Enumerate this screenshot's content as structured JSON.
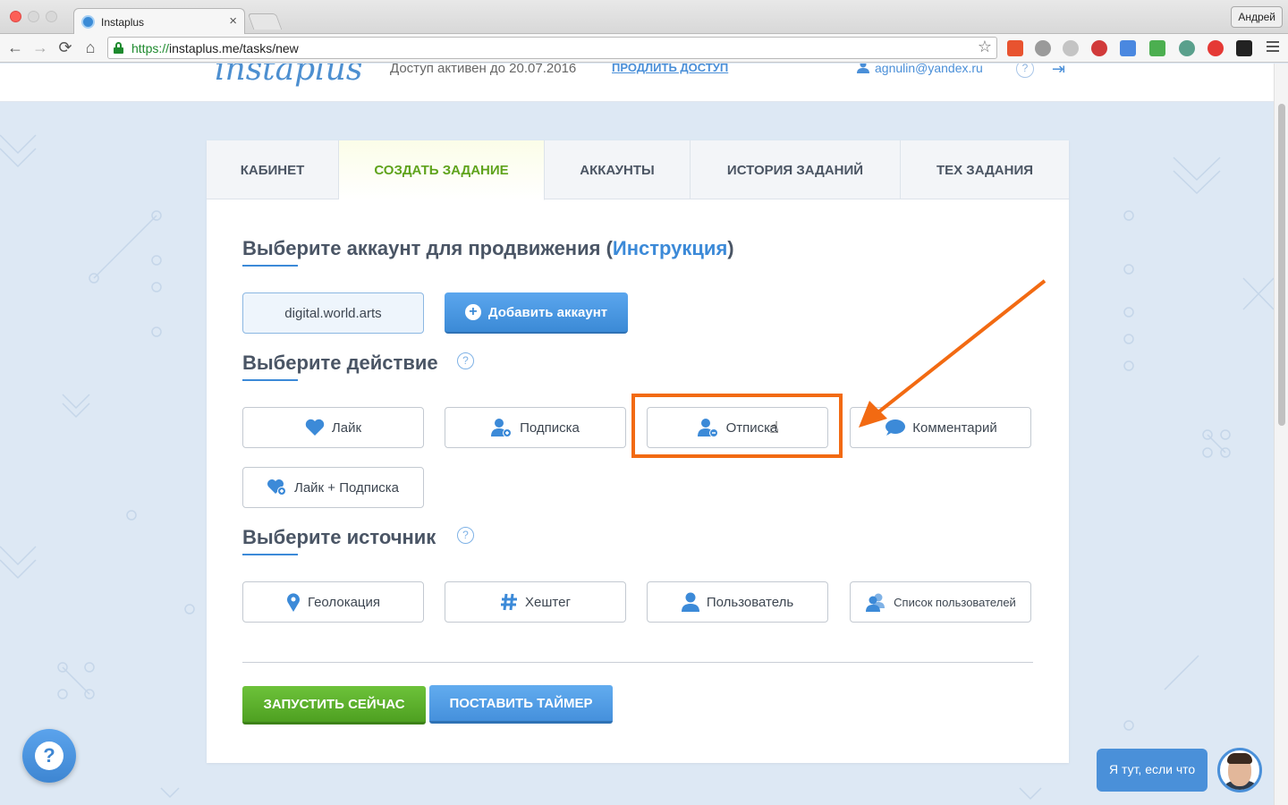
{
  "browser": {
    "tab_title": "Instaplus",
    "tab_close": "×",
    "profile": "Андрей",
    "url_scheme": "https://",
    "url_rest": "instaplus.me/tasks/new",
    "nav_back": "←",
    "nav_forward": "→",
    "nav_reload": "⟳",
    "nav_home": "⌂",
    "bookmark_star": "☆"
  },
  "header": {
    "logo": "instaplus",
    "access_text": "Доступ активен до 20.07.2016",
    "renew_link": "ПРОДЛИТЬ ДОСТУП",
    "email": "agnulin@yandex.ru",
    "help": "?",
    "logout": "⇥"
  },
  "tabs": [
    {
      "label": "КАБИНЕТ"
    },
    {
      "label": "СОЗДАТЬ ЗАДАНИЕ"
    },
    {
      "label": "АККАУНТЫ"
    },
    {
      "label": "ИСТОРИЯ ЗАДАНИЙ"
    },
    {
      "label": "ТЕХ ЗАДАНИЯ"
    }
  ],
  "section_account": {
    "heading_prefix": "Выберите аккаунт для продвижения (",
    "heading_link": "Инструкция",
    "heading_suffix": ")",
    "account_name": "digital.world.arts",
    "add_account": "Добавить аккаунт",
    "add_icon": "+"
  },
  "section_action": {
    "heading": "Выберите действие",
    "help": "?",
    "actions": [
      {
        "label": "Лайк",
        "icon": "heart-icon"
      },
      {
        "label": "Подписка",
        "icon": "user-plus-icon"
      },
      {
        "label": "Отписка",
        "icon": "user-minus-icon"
      },
      {
        "label": "Комментарий",
        "icon": "comment-icon"
      },
      {
        "label": "Лайк + Подписка",
        "icon": "heart-plus-icon"
      }
    ]
  },
  "section_source": {
    "heading": "Выберите источник",
    "help": "?",
    "sources": [
      {
        "label": "Геолокация",
        "icon": "location-pin-icon"
      },
      {
        "label": "Хештег",
        "icon": "hashtag-icon"
      },
      {
        "label": "Пользователь",
        "icon": "user-icon"
      },
      {
        "label": "Список пользователей",
        "icon": "users-icon"
      }
    ]
  },
  "footer_buttons": {
    "run": "ЗАПУСТИТЬ СЕЙЧАС",
    "timer": "ПОСТАВИТЬ ТАЙМЕР"
  },
  "widgets": {
    "help_bubble": "?",
    "chat_label": "Я тут, если что"
  },
  "colors": {
    "accent_blue": "#3c8ad8",
    "active_tab_green": "#5fa31c",
    "annotation_orange": "#f26a12",
    "page_bg": "#dde8f4"
  }
}
